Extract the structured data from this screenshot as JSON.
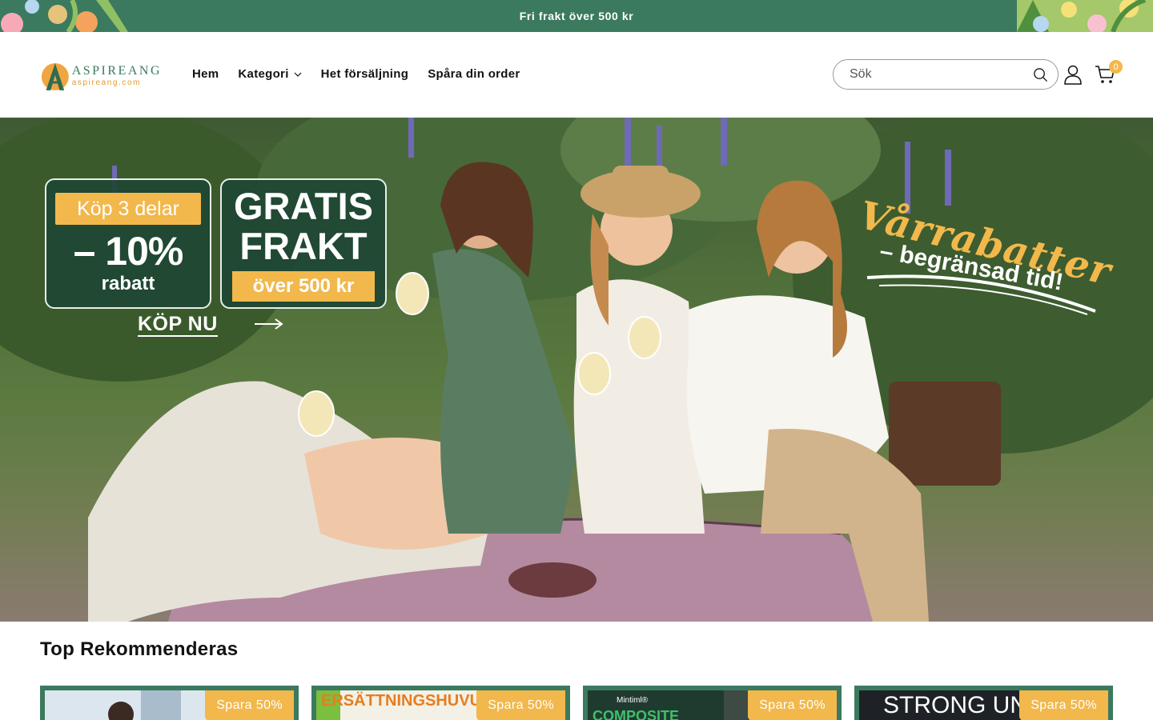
{
  "announcement": {
    "text": "Fri frakt över 500 kr"
  },
  "header": {
    "logo_name": "ASPIREANG",
    "logo_sub": "aspireang.com",
    "nav": [
      {
        "label": "Hem"
      },
      {
        "label": "Kategori",
        "has_dropdown": true
      },
      {
        "label": "Het försäljning"
      },
      {
        "label": "Spåra din order"
      }
    ],
    "search": {
      "placeholder": "Sök",
      "value": ""
    },
    "cart_count": "0"
  },
  "hero": {
    "promo1_tag": "Köp 3 delar",
    "promo1_big": "– 10%",
    "promo1_small": "rabatt",
    "promo2_line1": "GRATIS",
    "promo2_line2": "FRAKT",
    "promo2_tag": "över 500 kr",
    "cta": "KÖP NU",
    "spring_title": "Vårrabatter",
    "spring_sub": "– begränsad tid!"
  },
  "section": {
    "title": "Top Rekommenderas"
  },
  "products": [
    {
      "badge": "Spara 50%",
      "image_text": ""
    },
    {
      "badge": "Spara 50%",
      "image_text": "ERSÄTTNINGSHUVUD FÖR"
    },
    {
      "badge": "Spara 50%",
      "image_text": "COMPOSITE"
    },
    {
      "badge": "Spara 50%",
      "image_text": "STRONG UN"
    }
  ],
  "colors": {
    "brand_green": "#3b7a5e",
    "accent_yellow": "#f2b84b"
  }
}
